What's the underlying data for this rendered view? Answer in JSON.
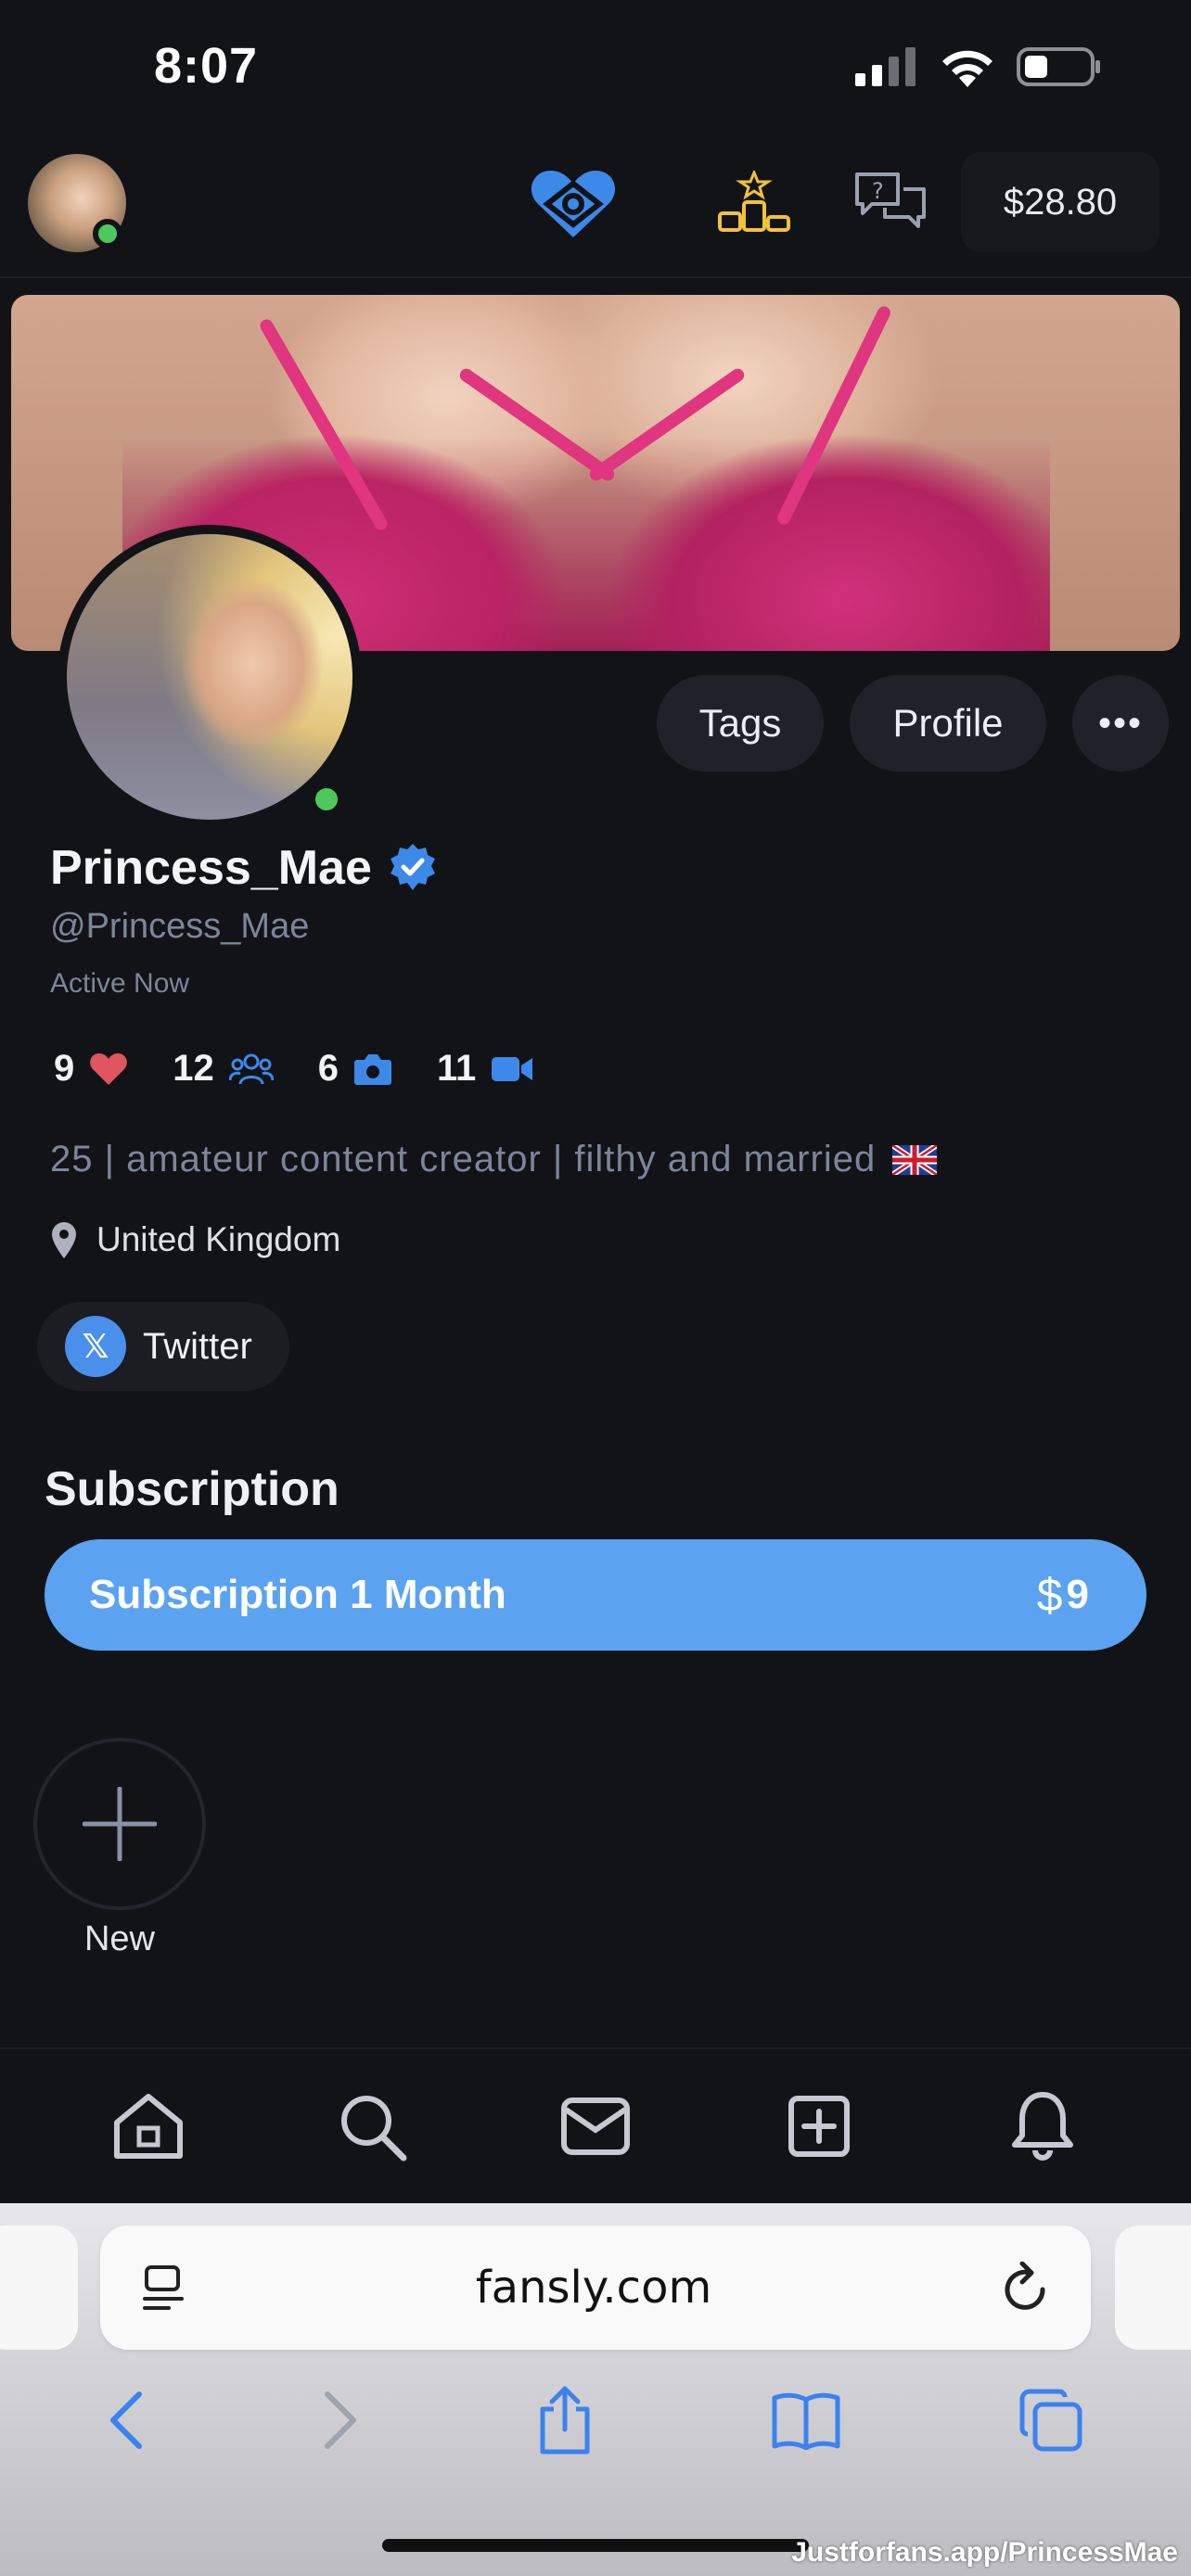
{
  "status_bar": {
    "time": "8:07"
  },
  "top_nav": {
    "balance": "$28.80",
    "icons": [
      "avatar",
      "fansly-heart-icon",
      "leaderboard-icon",
      "help-chat-icon"
    ]
  },
  "profile": {
    "display_name": "Princess_Mae",
    "handle": "@Princess_Mae",
    "activity": "Active Now",
    "stats": {
      "likes": "9",
      "followers": "12",
      "photos": "6",
      "videos": "11"
    },
    "bio": "25 | amateur content creator | filthy and married",
    "bio_flag": "uk-flag",
    "location": "United Kingdom",
    "social_link": "Twitter",
    "buttons": {
      "tags": "Tags",
      "profile": "Profile",
      "more": "•••"
    }
  },
  "subscription": {
    "heading": "Subscription",
    "tier_label": "Subscription 1 Month",
    "currency": "$",
    "price": "9"
  },
  "stories": {
    "new_label": "New"
  },
  "bottom_tabs": [
    "home-icon",
    "search-icon",
    "messages-icon",
    "create-post-icon",
    "notifications-icon"
  ],
  "browser": {
    "url": "fansly.com",
    "toolbar": [
      "back-icon",
      "forward-icon",
      "share-icon",
      "bookmarks-icon",
      "tabs-icon"
    ]
  },
  "watermark": "Justforfans.app/PrincessMae",
  "colors": {
    "background": "#121317",
    "accent_blue": "#5ba3f0",
    "online_green": "#4cc95d",
    "heart_red": "#e0555f",
    "muted_text": "#7d8599",
    "gold": "#f2c335"
  }
}
